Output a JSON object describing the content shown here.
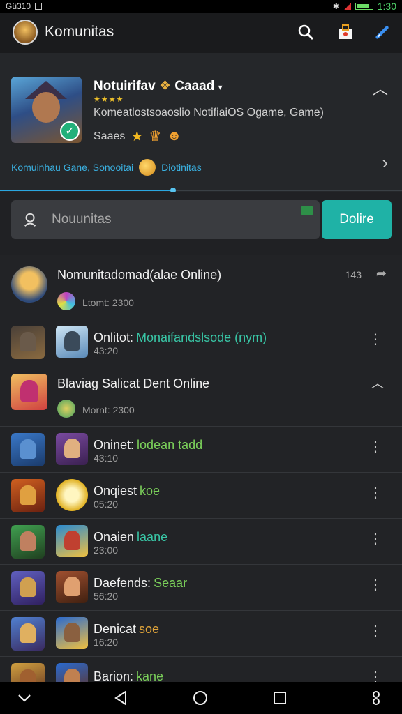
{
  "status_bar": {
    "left_text": "Gü310",
    "time": "1:30"
  },
  "app_bar": {
    "title": "Komunitas"
  },
  "featured": {
    "name": "Notuirifav",
    "name_suffix": "Caaad",
    "stars": "★★★★",
    "description": "Komeatlostsoaoslio NotifiaiOS Ogame, Game)",
    "sub_label": "Saaes",
    "link_text": "Komuinhau Gane, Sonooitai",
    "link_suffix": "Diotinitas",
    "progress_fraction": 0.43
  },
  "search": {
    "placeholder": "Nouunitas",
    "button_label": "Dolire"
  },
  "list": [
    {
      "title": "Nomunitadomad(alae Online)",
      "subtitle": "Ltomt: 2300",
      "count": "143",
      "type": "group-header"
    },
    {
      "title": "Onlitot:",
      "highlight": "Monaifandslsode (nym)",
      "highlight_color": "#39c6a6",
      "time": "43:20"
    },
    {
      "title": "Blaviag Salicat Dent Online",
      "subtitle": "Mornt: 2300",
      "type": "group-header-expanded"
    },
    {
      "title": "Oninet:",
      "highlight": "lodean tadd",
      "highlight_color": "#7bd05a",
      "time": "43:10"
    },
    {
      "title": "Onqiest",
      "highlight": "koe",
      "highlight_color": "#7bd05a",
      "time": "05:20"
    },
    {
      "title": "Onaien",
      "highlight": "laane",
      "highlight_color": "#39c6a6",
      "time": "23:00"
    },
    {
      "title": "Daefends:",
      "highlight": "Seaar",
      "highlight_color": "#7bd05a",
      "time": "56:20"
    },
    {
      "title": "Denicat",
      "highlight": "soe",
      "highlight_color": "#e2a53a",
      "time": "16:20"
    },
    {
      "title": "Barion:",
      "highlight": "kane",
      "highlight_color": "#7bd05a",
      "time": ""
    }
  ],
  "icons": {
    "search": "search-icon",
    "shop": "shopping-bag-icon",
    "edit": "pencil-icon",
    "share": "share-icon",
    "more": "more-vert-icon"
  },
  "colors": {
    "accent": "#1fb2a6",
    "link": "#3ab0e0",
    "background": "#1c1d1f"
  }
}
